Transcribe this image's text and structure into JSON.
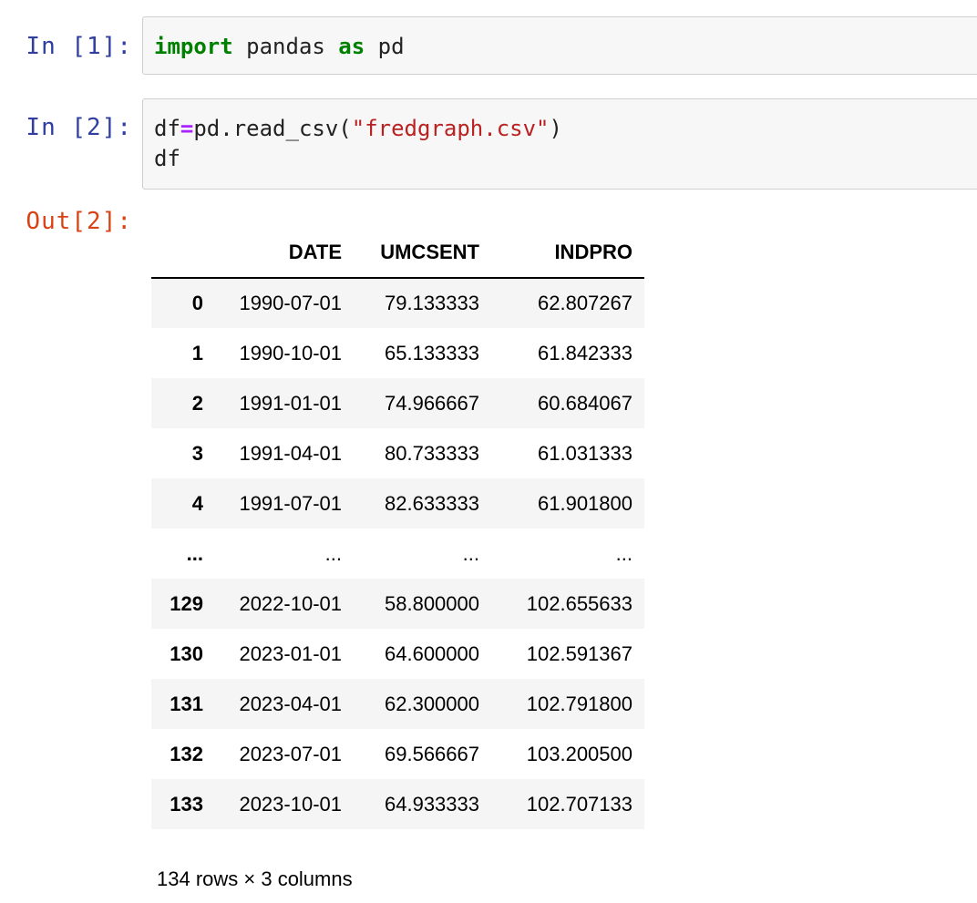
{
  "cells": [
    {
      "prompt": "In [1]:",
      "lines": [
        [
          {
            "t": "import",
            "c": "kw"
          },
          {
            "t": " pandas ",
            "c": ""
          },
          {
            "t": "as",
            "c": "kw"
          },
          {
            "t": " pd",
            "c": ""
          }
        ]
      ]
    },
    {
      "prompt": "In [2]:",
      "lines": [
        [
          {
            "t": "df",
            "c": ""
          },
          {
            "t": "=",
            "c": "op"
          },
          {
            "t": "pd.read_csv(",
            "c": ""
          },
          {
            "t": "\"fredgraph.csv\"",
            "c": "str"
          },
          {
            "t": ")",
            "c": ""
          }
        ],
        [
          {
            "t": "df",
            "c": ""
          }
        ]
      ]
    }
  ],
  "output": {
    "prompt": "Out[2]:",
    "table": {
      "columns": [
        "",
        "DATE",
        "UMCSENT",
        "INDPRO"
      ],
      "rows": [
        [
          "0",
          "1990-07-01",
          "79.133333",
          "62.807267"
        ],
        [
          "1",
          "1990-10-01",
          "65.133333",
          "61.842333"
        ],
        [
          "2",
          "1991-01-01",
          "74.966667",
          "60.684067"
        ],
        [
          "3",
          "1991-04-01",
          "80.733333",
          "61.031333"
        ],
        [
          "4",
          "1991-07-01",
          "82.633333",
          "61.901800"
        ],
        [
          "...",
          "...",
          "...",
          "..."
        ],
        [
          "129",
          "2022-10-01",
          "58.800000",
          "102.655633"
        ],
        [
          "130",
          "2023-01-01",
          "64.600000",
          "102.591367"
        ],
        [
          "131",
          "2023-04-01",
          "62.300000",
          "102.791800"
        ],
        [
          "132",
          "2023-07-01",
          "69.566667",
          "103.200500"
        ],
        [
          "133",
          "2023-10-01",
          "64.933333",
          "102.707133"
        ]
      ]
    },
    "shape": "134 rows × 3 columns"
  },
  "colors": {
    "in_prompt": "#303f9f",
    "out_prompt": "#d84315",
    "keyword": "#008000",
    "operator": "#aa22ff",
    "string": "#ba2121",
    "cell_background": "#f7f7f7",
    "row_stripe": "#f5f5f5"
  }
}
